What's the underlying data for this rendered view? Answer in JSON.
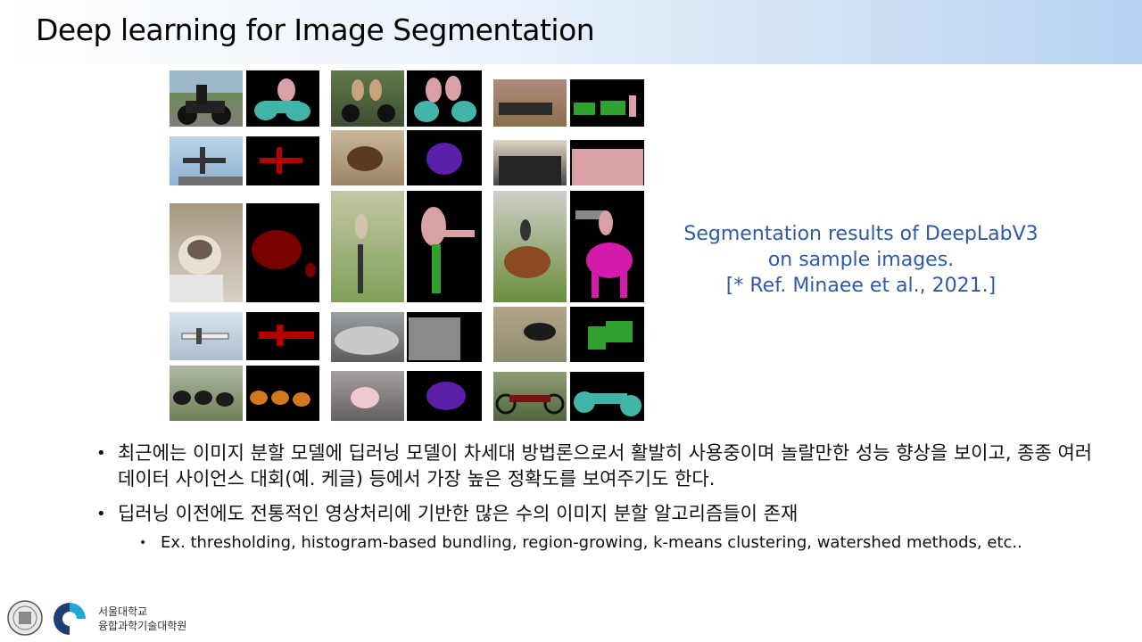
{
  "slide": {
    "title": "Deep learning for Image Segmentation"
  },
  "figure": {
    "caption_lines": [
      "Segmentation results of DeepLabV3",
      "on sample images.",
      "[* Ref. Minaee et al., 2021.]"
    ],
    "colors": {
      "person": "#d9a0a6",
      "motorbike": "#40b5a8",
      "aeroplane": "#b40000",
      "cat": "#7a0000",
      "dog": "#5b1fa8",
      "cow": "#2fa12f",
      "horse": "#d41aa8",
      "bicycle": "#2fa12f",
      "car": "#8a8a8a",
      "sheep": "#d2781e"
    }
  },
  "bullets": [
    {
      "text": "최근에는 이미지 분할 모델에 딥러닝 모델이 차세대 방법론으로서 활발히 사용중이며 놀랄만한 성능 향상을 보이고, 종종 여러 데이터 사이언스 대회(예. 케글) 등에서 가장 높은 정확도를 보여주기도 한다."
    },
    {
      "text": "딥러닝 이전에도 전통적인 영상처리에 기반한 많은 수의 이미지 분할 알고리즘들이 존재",
      "sub": "Ex. thresholding, histogram-based bundling, region-growing, k-means clustering, watershed methods, etc.."
    }
  ],
  "footer": {
    "school_line1": "서울대학교",
    "school_line2": "융합과학기술대학원"
  }
}
